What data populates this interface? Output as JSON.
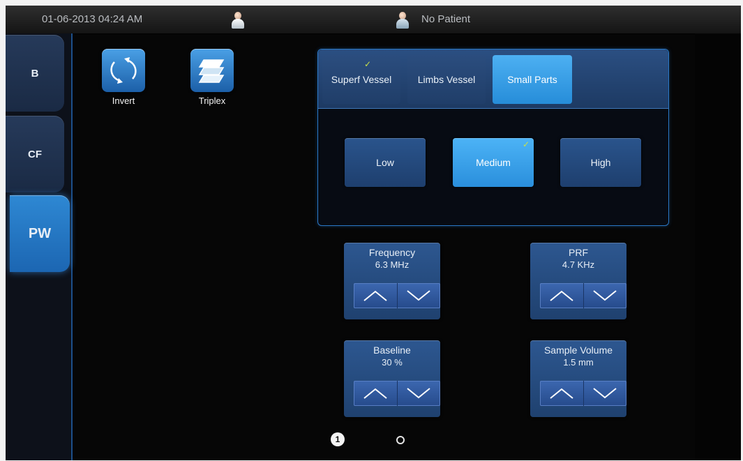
{
  "status": {
    "datetime": "01-06-2013 04:24 AM",
    "patient": "No Patient",
    "icons": [
      "operator-icon",
      "patient-icon"
    ]
  },
  "mode_tabs": [
    {
      "label": "B"
    },
    {
      "label": "CF"
    },
    {
      "label": "PW",
      "active": true
    }
  ],
  "tools": {
    "invert": {
      "label": "Invert",
      "icon": "invert-icon"
    },
    "triplex": {
      "label": "Triplex",
      "icon": "triplex-icon"
    }
  },
  "presets": {
    "tabs": [
      "Superf Vessel",
      "Limbs Vessel",
      "Small Parts"
    ],
    "selected_tab": "Small Parts",
    "checked_tab": "Superf Vessel",
    "levels": [
      "Low",
      "Medium",
      "High"
    ],
    "selected_level": "Medium",
    "check_glyph": "✓"
  },
  "params": {
    "frequency": {
      "label": "Frequency",
      "value": "6.3 MHz"
    },
    "prf": {
      "label": "PRF",
      "value": "4.7 KHz"
    },
    "baseline": {
      "label": "Baseline",
      "value": "30 %"
    },
    "sample_volume": {
      "label": "Sample Volume",
      "value": "1.5 mm"
    }
  },
  "pager": {
    "current": "1",
    "total_pages": 2
  },
  "colors": {
    "accent": "#2a8fdc",
    "panel": "#1f416f",
    "check": "#c8e04a"
  }
}
